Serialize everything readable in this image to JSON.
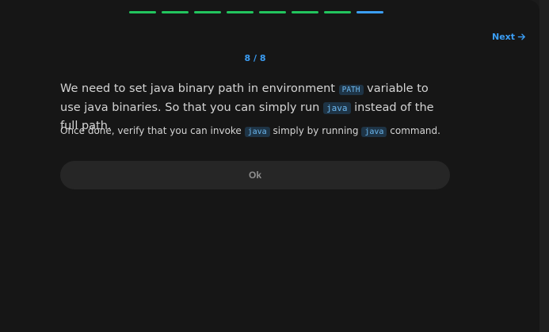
{
  "progress": {
    "total_steps": 8,
    "current_step": 8
  },
  "nav": {
    "next_label": "Next"
  },
  "counter": {
    "text": "8 / 8"
  },
  "content": {
    "main_part1": "We need to set java binary path in environment ",
    "main_code1": "PATH",
    "main_part2": " variable to use java binaries. So that you can simply run ",
    "main_code2": "java",
    "main_part3": " instead of the full path.",
    "sub_part1": "Once done, verify that you can invoke ",
    "sub_code1": "java",
    "sub_part2": " simply by running ",
    "sub_code2": "java",
    "sub_part3": " command."
  },
  "actions": {
    "ok_label": "Ok"
  },
  "colors": {
    "completed": "#22c55e",
    "active": "#3b9ef5",
    "accent": "#3b9ef5"
  },
  "icons": {
    "next": "arrow-right-icon"
  }
}
